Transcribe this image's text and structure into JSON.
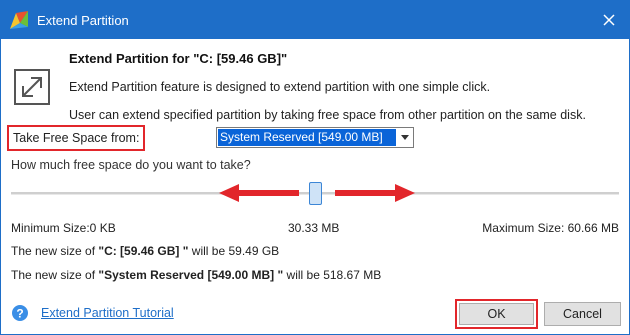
{
  "window": {
    "title": "Extend Partition",
    "icon": "app-logo-icon",
    "close_icon": "close-icon"
  },
  "header": {
    "heading": "Extend Partition for \"C: [59.46 GB]\"",
    "description1": "Extend Partition feature is designed to extend partition with one simple click.",
    "description2": "User can extend specified partition by taking free space from other partition on the same disk.",
    "icon": "extend-partition-icon"
  },
  "source": {
    "label": "Take Free Space from:",
    "selected": "System Reserved [549.00 MB]"
  },
  "slider": {
    "question": "How much free space do you want to take?",
    "min_label": "Minimum Size:0 KB",
    "current_label": "30.33 MB",
    "max_label": "Maximum Size: 60.66 MB",
    "value_fraction": 0.5
  },
  "results": {
    "line1_prefix": "The new size of ",
    "line1_name": "\"C: [59.46 GB] \"",
    "line1_suffix": " will be 59.49 GB",
    "line2_prefix": "The new size of ",
    "line2_name": "\"System Reserved [549.00 MB] \"",
    "line2_suffix": " will be 518.67 MB"
  },
  "footer": {
    "tutorial_link": "Extend Partition Tutorial",
    "ok_label": "OK",
    "cancel_label": "Cancel"
  },
  "colors": {
    "titlebar": "#1e6ec8",
    "highlight": "#e2262b",
    "selection": "#0a64d8"
  }
}
